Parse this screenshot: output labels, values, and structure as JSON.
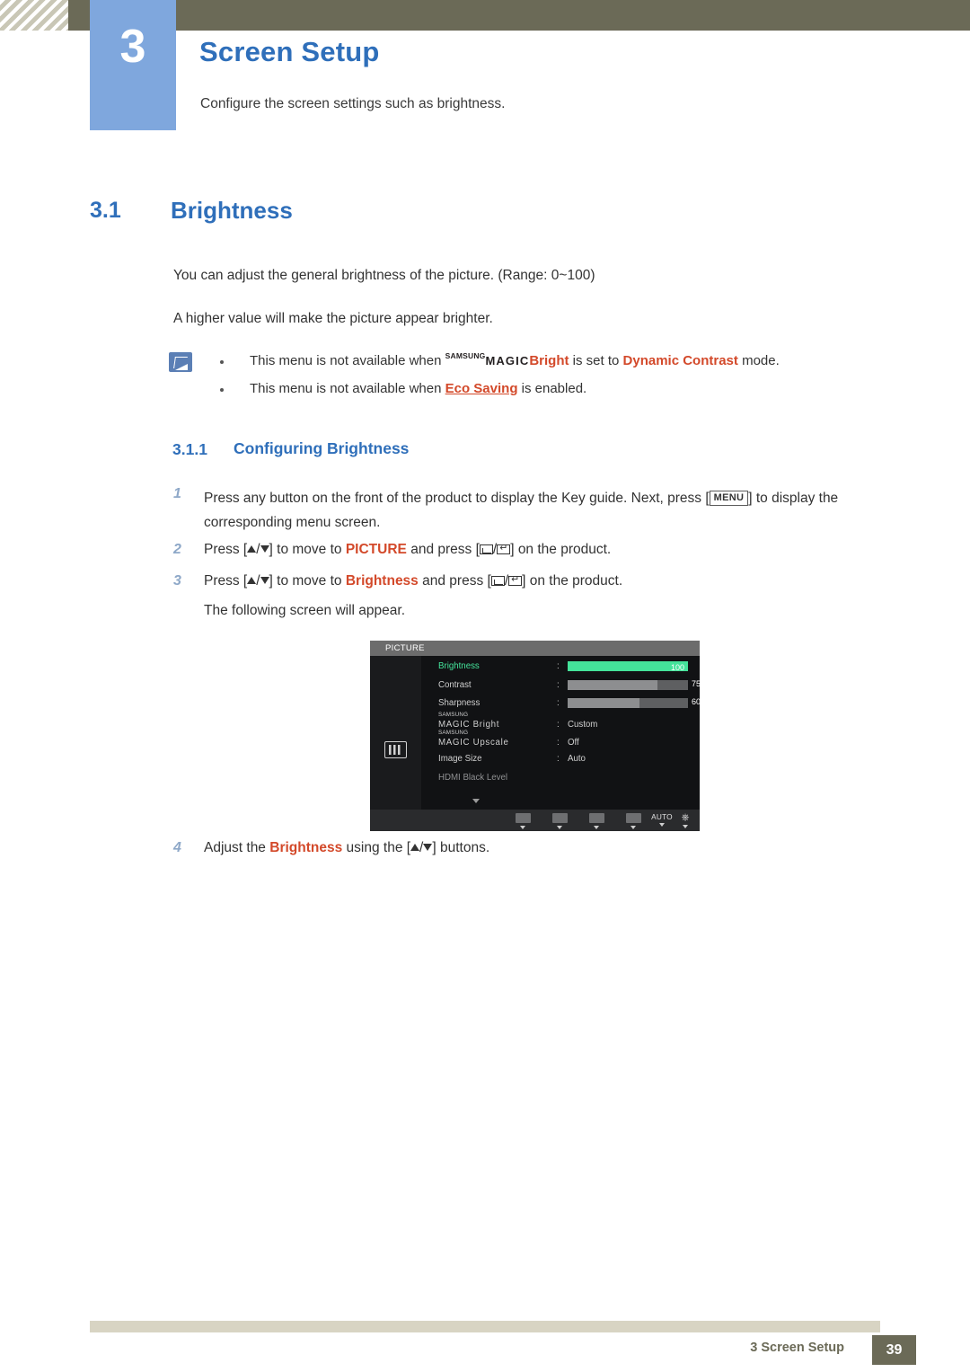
{
  "header": {
    "chapter_number": "3",
    "chapter_title": "Screen Setup",
    "chapter_desc": "Configure the screen settings such as brightness."
  },
  "section": {
    "number": "3.1",
    "title": "Brightness",
    "paragraph_1": "You can adjust the general brightness of the picture. (Range: 0~100)",
    "paragraph_2": "A higher value will make the picture appear brighter."
  },
  "notes": {
    "icon": "note-pencil-icon",
    "items": [
      {
        "prefix": "This menu is not available when ",
        "magic_sup": "SAMSUNG",
        "magic_word": "MAGIC",
        "magic_suffix": "Bright",
        "middle": " is set to ",
        "highlight": "Dynamic Contrast",
        "suffix": " mode."
      },
      {
        "prefix": "This menu is not available when ",
        "highlight": "Eco Saving",
        "suffix": " is enabled."
      }
    ]
  },
  "subsection": {
    "number": "3.1.1",
    "title": "Configuring Brightness"
  },
  "steps": {
    "one": {
      "num": "1",
      "text_a": "Press any button on the front of the product to display the Key guide. Next, press [",
      "keycap": "MENU",
      "text_b": "] to display the corresponding menu screen."
    },
    "two": {
      "num": "2",
      "text_a": "Press [",
      "sep": "/",
      "text_b": "] to move to ",
      "target": "PICTURE",
      "text_c": " and press [",
      "text_d": "] on the product."
    },
    "three": {
      "num": "3",
      "text_a": "Press [",
      "sep": "/",
      "text_b": "] to move to ",
      "target": "Brightness",
      "text_c": " and press [",
      "text_d": "] on the product.",
      "text_e": "The following screen will appear."
    },
    "four": {
      "num": "4",
      "text_a": "Adjust the ",
      "target": "Brightness",
      "text_b": " using the [",
      "sep": "/",
      "text_c": "] buttons."
    }
  },
  "osd": {
    "title": "PICTURE",
    "sidebar_icon": "picture-sliders-icon",
    "rows": [
      {
        "label": "Brightness",
        "type": "bar",
        "value": 100,
        "selected": true
      },
      {
        "label": "Contrast",
        "type": "bar",
        "value": 75,
        "selected": false
      },
      {
        "label": "Sharpness",
        "type": "bar",
        "value": 60,
        "selected": false
      },
      {
        "label": "MAGIC Bright",
        "sup": "SAMSUNG",
        "type": "value",
        "value": "Custom",
        "selected": false
      },
      {
        "label": "MAGIC Upscale",
        "sup": "SAMSUNG",
        "type": "value",
        "value": "Off",
        "selected": false
      },
      {
        "label": "Image Size",
        "type": "value",
        "value": "Auto",
        "selected": false
      },
      {
        "label": "HDMI Black Level",
        "type": "none",
        "value": "",
        "selected": false
      }
    ],
    "footer_keys": [
      "left-arrow-key",
      "minus-key",
      "plus-key",
      "enter-key",
      "AUTO",
      "power-key"
    ],
    "auto_label": "AUTO",
    "colors": {
      "accent": "#44e39a",
      "track": "#5e5f61",
      "background": "#111214",
      "titlebar": "#6c6c6c"
    }
  },
  "footer": {
    "text": "3 Screen Setup",
    "page": "39"
  },
  "theme": {
    "heading_blue": "#2f6fba",
    "accent_red": "#d3492a",
    "olive": "#6b6a57",
    "chapter_box_blue": "#7fa7dd"
  }
}
